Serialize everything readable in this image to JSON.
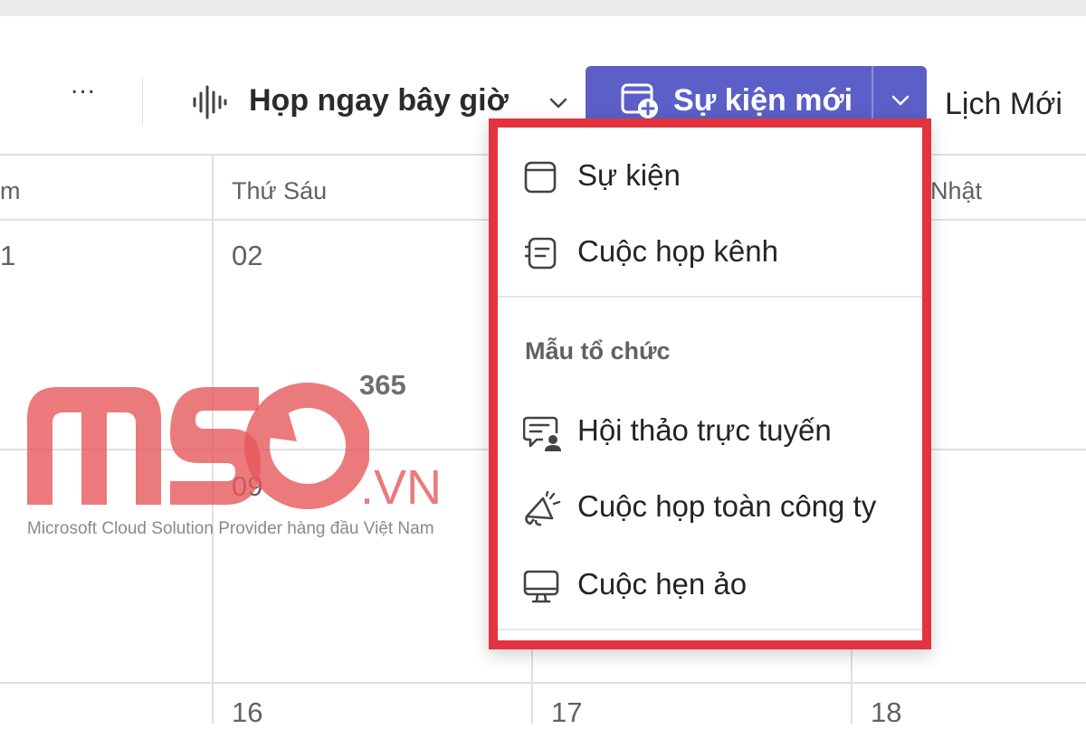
{
  "toolbar": {
    "more_label": "...",
    "meet_now_label": "Họp ngay bây giờ",
    "new_event_label": "Sự kiện mới",
    "new_calendar_label": "Lịch Mới",
    "accent_color": "#5b5fc7"
  },
  "calendar": {
    "day_headers": [
      "m",
      "Thứ Sáu",
      "Nhật"
    ],
    "dates": [
      "1",
      "02",
      "09",
      "16",
      "17",
      "18"
    ]
  },
  "dropdown": {
    "highlight_color": "#e2343f",
    "items": [
      {
        "label": "Sự kiện",
        "icon": "calendar-icon"
      },
      {
        "label": "Cuộc họp kênh",
        "icon": "channel-meeting-icon"
      }
    ],
    "section_title": "Mẫu tổ chức",
    "templates": [
      {
        "label": "Hội thảo trực tuyến",
        "icon": "webinar-icon"
      },
      {
        "label": "Cuộc họp toàn công ty",
        "icon": "megaphone-icon"
      },
      {
        "label": "Cuộc hẹn ảo",
        "icon": "monitor-icon"
      }
    ]
  },
  "watermark": {
    "superscript": "365",
    "domain": ".VN",
    "tagline": "Microsoft Cloud Solution Provider hàng đầu Việt Nam",
    "logo_color": "#e7595d"
  }
}
